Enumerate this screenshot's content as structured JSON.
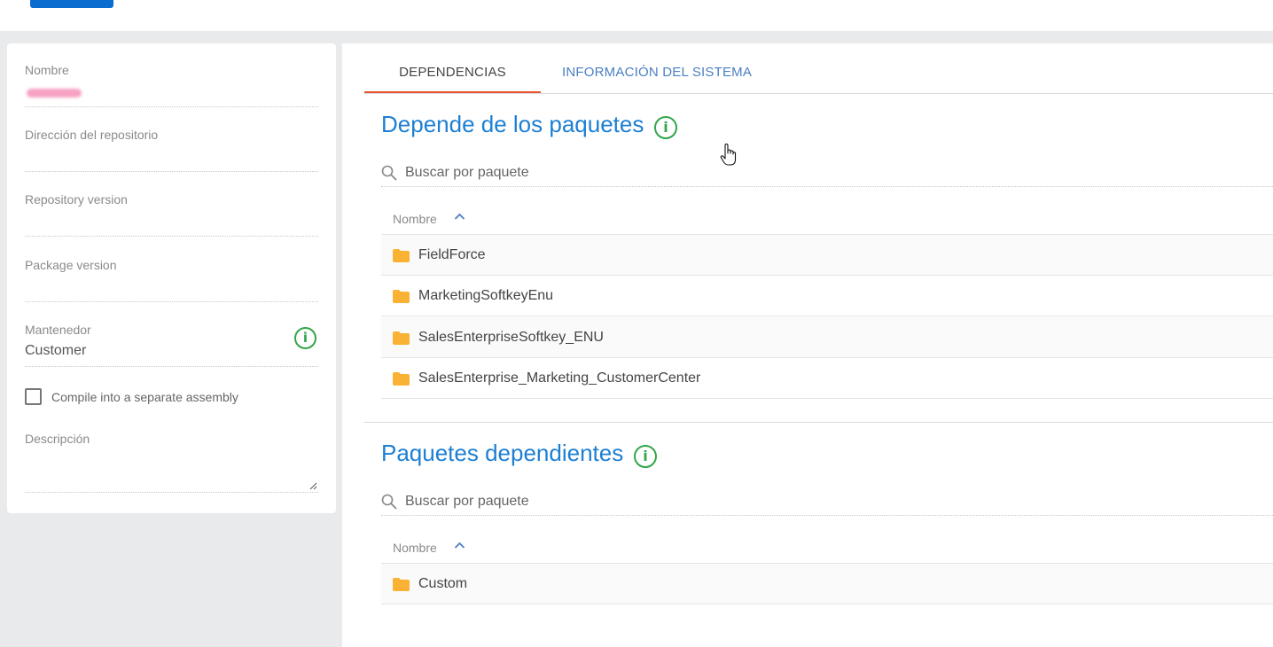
{
  "left": {
    "fields": [
      {
        "label": "Nombre",
        "value": ""
      },
      {
        "label": "Dirección del repositorio",
        "value": ""
      },
      {
        "label": "Repository version",
        "value": ""
      },
      {
        "label": "Package version",
        "value": ""
      },
      {
        "label": "Mantenedor",
        "value": "Customer"
      }
    ],
    "checkbox_label": "Compile into a separate assembly",
    "checkbox_checked": false,
    "description_label": "Descripción"
  },
  "tabs": [
    {
      "label": "DEPENDENCIAS",
      "active": true
    },
    {
      "label": "INFORMACIÓN DEL SISTEMA",
      "active": false
    }
  ],
  "sections": [
    {
      "title": "Depende de los paquetes",
      "search_placeholder": "Buscar por paquete",
      "column_header": "Nombre",
      "rows": [
        "FieldForce",
        "MarketingSoftkeyEnu",
        "SalesEnterpriseSoftkey_ENU",
        "SalesEnterprise_Marketing_CustomerCenter"
      ]
    },
    {
      "title": "Paquetes dependientes",
      "search_placeholder": "Buscar por paquete",
      "column_header": "Nombre",
      "rows": [
        "Custom"
      ]
    }
  ],
  "info_glyph": "i",
  "colors": {
    "accent_blue": "#1d7fd3",
    "tab_underline": "#e8542e",
    "info_green": "#31a64a",
    "folder": "#f9b233",
    "primary_button": "#0b6ccf"
  }
}
